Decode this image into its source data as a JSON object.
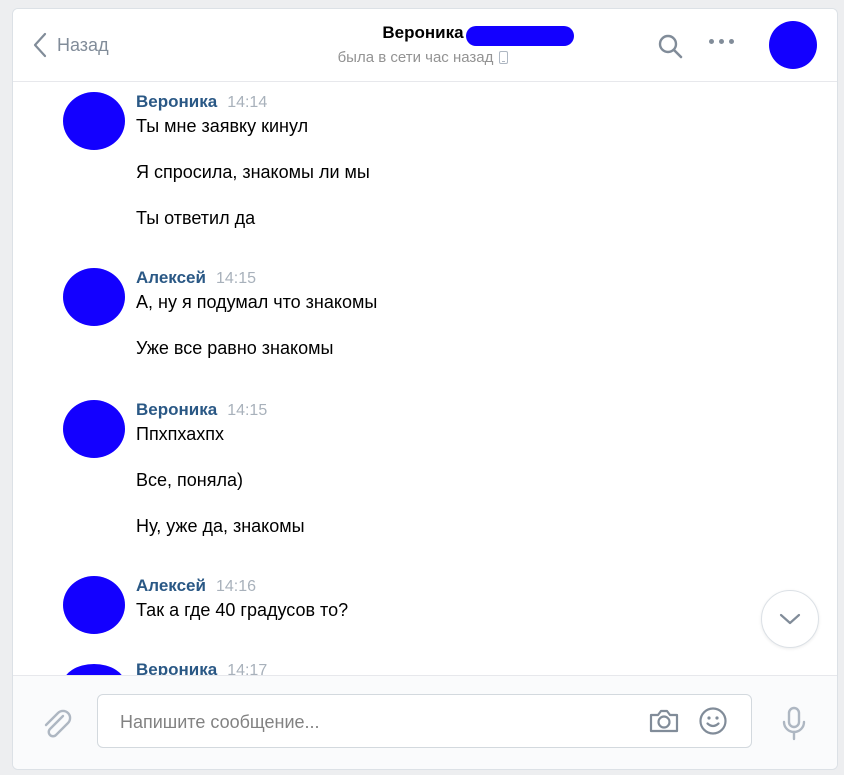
{
  "header": {
    "back_label": "Назад",
    "contact_name": "Вероника",
    "status": "была в сети час назад",
    "icons": {
      "back": "chevron-left-icon",
      "search": "search-icon",
      "more": "more-horizontal-icon",
      "device": "mobile-phone-icon"
    }
  },
  "messages": [
    {
      "author": "Вероника",
      "time": "14:14",
      "texts": [
        "Ты мне заявку кинул",
        "Я спросила, знакомы ли мы",
        "Ты ответил да"
      ]
    },
    {
      "author": "Алексей",
      "time": "14:15",
      "texts": [
        "А, ну я подумал что знакомы",
        "Уже все равно знакомы"
      ]
    },
    {
      "author": "Вероника",
      "time": "14:15",
      "texts": [
        "Ппхпхахпх",
        "Все, поняла)",
        "Ну, уже да, знакомы"
      ]
    },
    {
      "author": "Алексей",
      "time": "14:16",
      "texts": [
        "Так а где 40 градусов то?"
      ]
    },
    {
      "author": "Вероника",
      "time": "14:17",
      "texts": []
    }
  ],
  "composer": {
    "placeholder": "Напишите сообщение...",
    "value": "",
    "icons": {
      "attach": "paperclip-icon",
      "camera": "camera-icon",
      "emoji": "smile-icon",
      "voice": "microphone-icon"
    }
  },
  "colors": {
    "author": "#2a5885",
    "time": "#a8b1bb",
    "redaction": "#1300ff",
    "muted": "#818c99"
  }
}
